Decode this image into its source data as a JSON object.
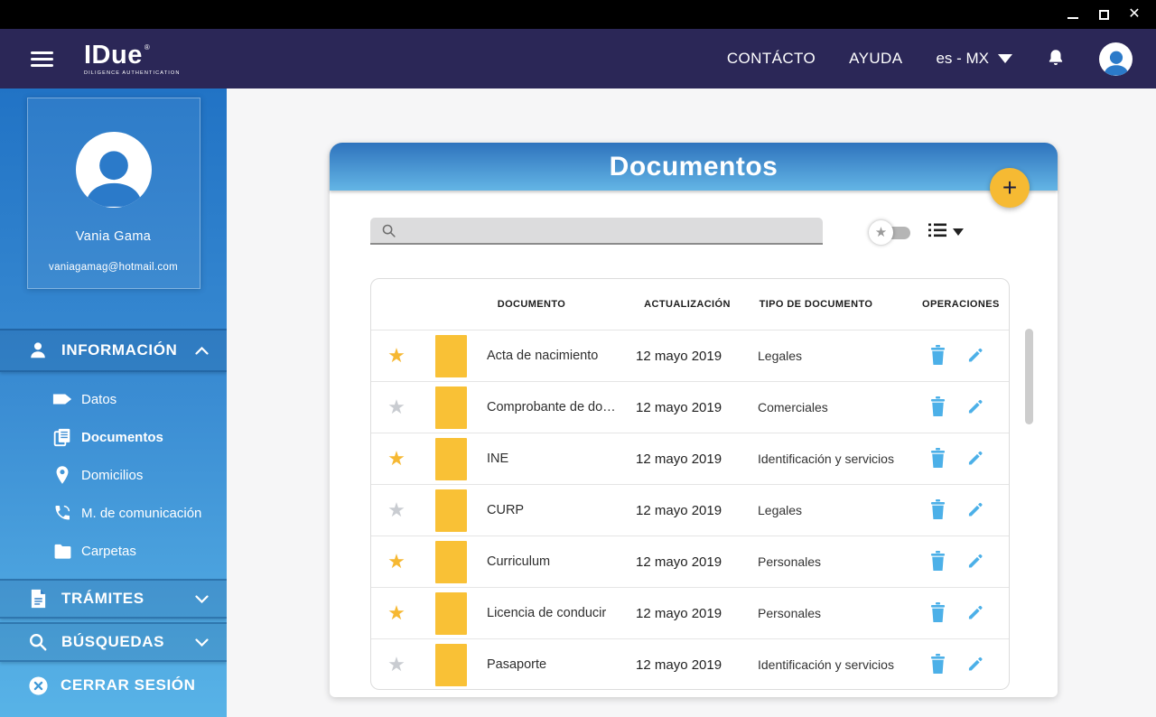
{
  "titlebar": {
    "controls": [
      "minimize",
      "maximize",
      "close"
    ]
  },
  "topbar": {
    "brand": {
      "name": "IDue",
      "registered": "®",
      "tagline": "DILIGENCE AUTHENTICATION"
    },
    "links": {
      "contact": "CONTÁCTO",
      "help": "AYUDA"
    },
    "language": {
      "value": "es - MX"
    },
    "icons": {
      "menu": "hamburger-menu",
      "bell": "notification-bell",
      "avatar": "user-avatar"
    }
  },
  "sidebar": {
    "profile": {
      "name": "Vania Gama",
      "email": "vaniagamag@hotmail.com"
    },
    "info_section": {
      "label": "INFORMACIÓN",
      "state": "expanded"
    },
    "items": [
      {
        "label": "Datos",
        "icon": "tag-icon",
        "active": false
      },
      {
        "label": "Documentos",
        "icon": "documents-icon",
        "active": true
      },
      {
        "label": "Domicilios",
        "icon": "map-pin-icon",
        "active": false
      },
      {
        "label": "M. de comunicación",
        "icon": "phone-icon",
        "active": false
      },
      {
        "label": "Carpetas",
        "icon": "folder-icon",
        "active": false
      }
    ],
    "tramites_section": {
      "label": "TRÁMITES",
      "state": "collapsed"
    },
    "busquedas_section": {
      "label": "BÚSQUEDAS",
      "state": "collapsed"
    },
    "logout": {
      "label": "CERRAR SESIÓN"
    }
  },
  "main": {
    "title": "Documentos",
    "fab": "+",
    "search": {
      "value": "",
      "placeholder": ""
    },
    "filters": {
      "favorites_toggle": "star-toggle",
      "view_selector": "list-view-dropdown"
    },
    "table": {
      "headers": [
        "DOCUMENTO",
        "ACTUALIZACIÓN",
        "TIPO DE DOCUMENTO",
        "OPERACIONES"
      ],
      "rows": [
        {
          "starred": true,
          "name": "Acta de nacimiento",
          "updated": "12 mayo 2019",
          "type": "Legales"
        },
        {
          "starred": false,
          "name": "Comprobante de do…",
          "updated": "12 mayo 2019",
          "type": "Comerciales"
        },
        {
          "starred": true,
          "name": "INE",
          "updated": "12 mayo 2019",
          "type": "Identificación y servicios"
        },
        {
          "starred": false,
          "name": "CURP",
          "updated": "12 mayo 2019",
          "type": "Legales"
        },
        {
          "starred": true,
          "name": "Curriculum",
          "updated": "12 mayo 2019",
          "type": "Personales"
        },
        {
          "starred": true,
          "name": "Licencia de conducir",
          "updated": "12 mayo 2019",
          "type": "Personales"
        },
        {
          "starred": false,
          "name": "Pasaporte",
          "updated": "12 mayo 2019",
          "type": "Identificación y servicios"
        }
      ]
    }
  },
  "colors": {
    "navbar": "#2b2757",
    "sidebar_top": "#2173c5",
    "sidebar_bottom": "#58b3e7",
    "header_gradient_top": "#2e73bd",
    "header_gradient_bottom": "#63b5e5",
    "gold": "#f6ba33",
    "icon_blue": "#4cb0e8"
  }
}
